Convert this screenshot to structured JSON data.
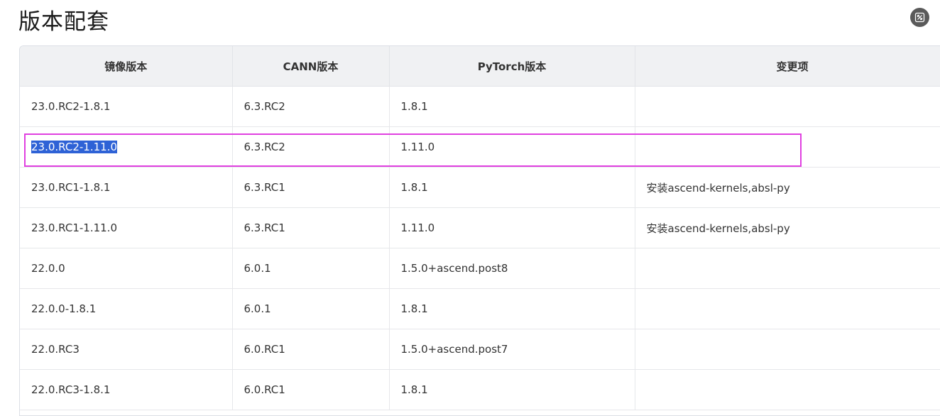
{
  "page": {
    "title": "版本配套"
  },
  "icons": {
    "expand": "expand-icon"
  },
  "colors": {
    "header_bg": "#f0f1f3",
    "highlight_border": "#e040e0",
    "selection_bg": "#2e62d6"
  },
  "table": {
    "headers": [
      "镜像版本",
      "CANN版本",
      "PyTorch版本",
      "变更项"
    ],
    "rows": [
      [
        "23.0.RC2-1.8.1",
        "6.3.RC2",
        "1.8.1",
        ""
      ],
      [
        "23.0.RC2-1.11.0",
        "6.3.RC2",
        "1.11.0",
        ""
      ],
      [
        "23.0.RC1-1.8.1",
        "6.3.RC1",
        "1.8.1",
        "安装ascend-kernels,absl-py"
      ],
      [
        "23.0.RC1-1.11.0",
        "6.3.RC1",
        "1.11.0",
        "安装ascend-kernels,absl-py"
      ],
      [
        "22.0.0",
        "6.0.1",
        "1.5.0+ascend.post8",
        ""
      ],
      [
        "22.0.0-1.8.1",
        "6.0.1",
        "1.8.1",
        ""
      ],
      [
        "22.0.RC3",
        "6.0.RC1",
        "1.5.0+ascend.post7",
        ""
      ],
      [
        "22.0.RC3-1.8.1",
        "6.0.RC1",
        "1.8.1",
        ""
      ]
    ]
  }
}
